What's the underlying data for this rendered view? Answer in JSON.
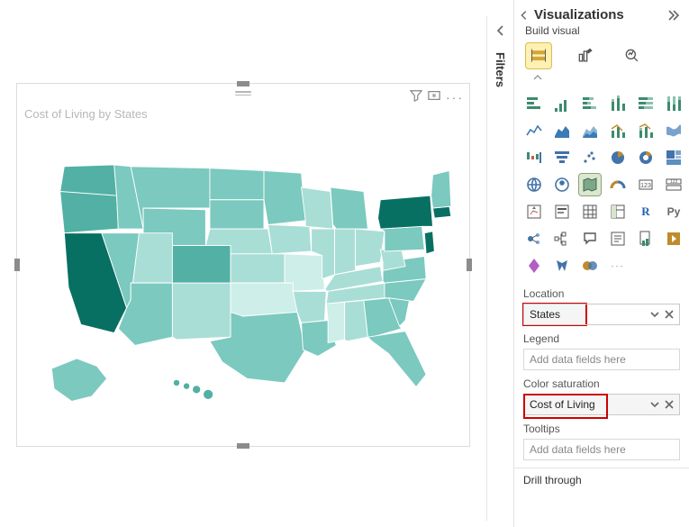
{
  "canvas": {
    "viz_title": "Cost of Living by States"
  },
  "filters": {
    "label": "Filters"
  },
  "pane": {
    "title": "Visualizations",
    "subtitle": "Build visual",
    "location": {
      "label": "Location",
      "value": "States"
    },
    "legend": {
      "label": "Legend",
      "placeholder": "Add data fields here"
    },
    "saturation": {
      "label": "Color saturation",
      "value": "Cost of Living"
    },
    "tooltips": {
      "label": "Tooltips",
      "placeholder": "Add data fields here"
    },
    "drill": {
      "label": "Drill through"
    }
  },
  "map": {
    "states": [
      {
        "abbr": "CA",
        "name": "California",
        "shade": "darkest"
      },
      {
        "abbr": "NY",
        "name": "New York",
        "shade": "darkest"
      },
      {
        "abbr": "MA",
        "name": "Massachusetts",
        "shade": "darkest"
      },
      {
        "abbr": "NJ",
        "name": "New Jersey",
        "shade": "darkest"
      },
      {
        "abbr": "CO",
        "name": "Colorado",
        "shade": "darker"
      },
      {
        "abbr": "WA",
        "name": "Washington",
        "shade": "darker"
      },
      {
        "abbr": "OR",
        "name": "Oregon",
        "shade": "darker"
      },
      {
        "abbr": "OK",
        "name": "Oklahoma",
        "shade": "lightest"
      },
      {
        "abbr": "MO",
        "name": "Missouri",
        "shade": "lightest"
      },
      {
        "abbr": "MS",
        "name": "Mississippi",
        "shade": "lightest"
      },
      {
        "abbr": "WV",
        "name": "West Virginia",
        "shade": "lighter"
      }
    ]
  },
  "viz_icons": [
    "stacked-bar",
    "clustered-bar",
    "stacked-column",
    "clustered-column",
    "stacked-bar-100",
    "clustered-column-100",
    "line",
    "area",
    "stacked-area",
    "line-clustered",
    "line-stacked",
    "ribbon",
    "waterfall",
    "funnel",
    "scatter",
    "pie",
    "donut",
    "treemap",
    "map",
    "filled-map",
    "shape-map",
    "gauge",
    "card",
    "kpi",
    "multi-row",
    "slicer",
    "table",
    "matrix",
    "r-visual",
    "py-visual",
    "key-influencers",
    "decomposition",
    "qa",
    "narrative",
    "paginated",
    "powerapps",
    "powerautomate",
    "import",
    "more"
  ]
}
